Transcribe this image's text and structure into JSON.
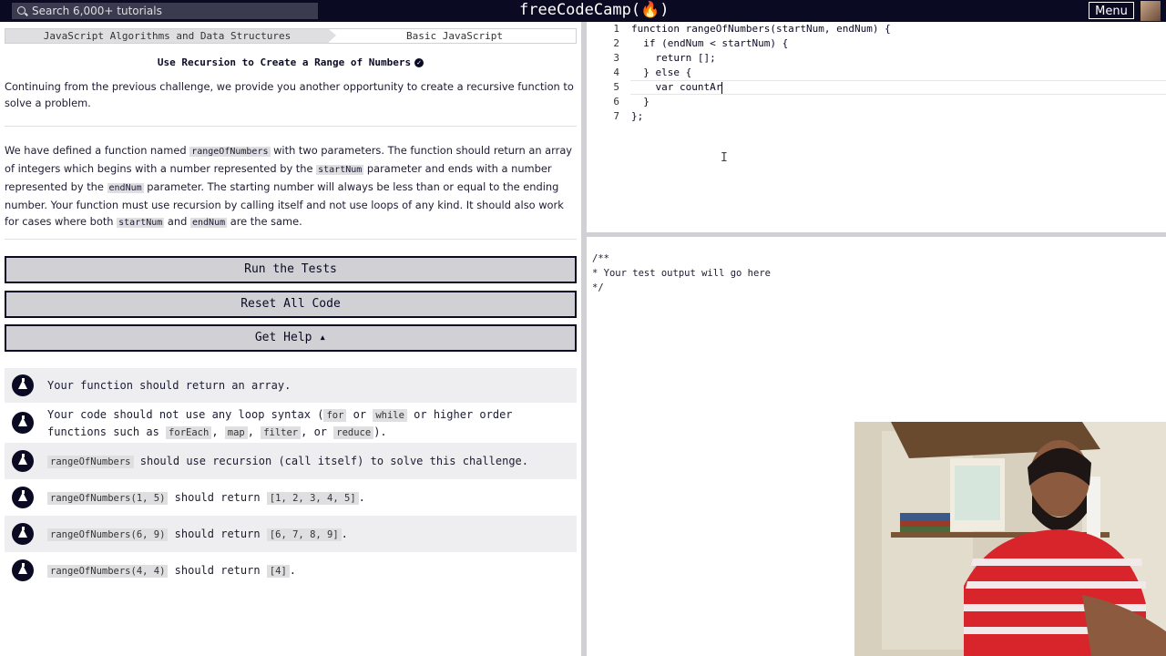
{
  "topbar": {
    "search_placeholder": "Search 6,000+ tutorials",
    "brand": "freeCodeCamp(🔥)",
    "menu_label": "Menu"
  },
  "breadcrumb": {
    "course": "JavaScript Algorithms and Data Structures",
    "section": "Basic JavaScript"
  },
  "challenge": {
    "title": "Use Recursion to Create a Range of Numbers",
    "intro": "Continuing from the previous challenge, we provide you another opportunity to create a recursive function to solve a problem.",
    "desc": {
      "p1": "We have defined a function named ",
      "c1": "rangeOfNumbers",
      "p2": " with two parameters. The function should return an array of integers which begins with a number represented by the ",
      "c2": "startNum",
      "p3": " parameter and ends with a number represented by the ",
      "c3": "endNum",
      "p4": " parameter. The starting number will always be less than or equal to the ending number. Your function must use recursion by calling itself and not use loops of any kind. It should also work for cases where both ",
      "c4": "startNum",
      "p5": " and ",
      "c5": "endNum",
      "p6": " are the same."
    }
  },
  "buttons": {
    "run": "Run the Tests",
    "reset": "Reset All Code",
    "help": "Get Help ▴"
  },
  "tests": [
    {
      "text": "Your function should return an array."
    },
    {
      "a": "Your code should not use any loop syntax (",
      "c1": "for",
      "b": " or ",
      "c2": "while",
      "c": " or higher order functions such as ",
      "c3": "forEach",
      "d": ", ",
      "c4": "map",
      "e": ", ",
      "c5": "filter",
      "f": ", or ",
      "c6": "reduce",
      "g": ")."
    },
    {
      "code": "rangeOfNumbers",
      "text": " should use recursion (call itself) to solve this challenge."
    },
    {
      "code": "rangeOfNumbers(1, 5)",
      "mid": " should return ",
      "result": "[1, 2, 3, 4, 5]",
      "end": "."
    },
    {
      "code": "rangeOfNumbers(6, 9)",
      "mid": " should return ",
      "result": "[6, 7, 8, 9]",
      "end": "."
    },
    {
      "code": "rangeOfNumbers(4, 4)",
      "mid": " should return ",
      "result": "[4]",
      "end": "."
    }
  ],
  "editor": {
    "lines": [
      {
        "n": "1",
        "code": "function rangeOfNumbers(startNum, endNum) {"
      },
      {
        "n": "2",
        "code": "  if (endNum < startNum) {"
      },
      {
        "n": "3",
        "code": "    return [];"
      },
      {
        "n": "4",
        "code": "  } else {"
      },
      {
        "n": "5",
        "code": "    var countAr"
      },
      {
        "n": "6",
        "code": "  }"
      },
      {
        "n": "7",
        "code": "};"
      }
    ]
  },
  "output": {
    "text": "/**\n* Your test output will go here\n*/"
  }
}
